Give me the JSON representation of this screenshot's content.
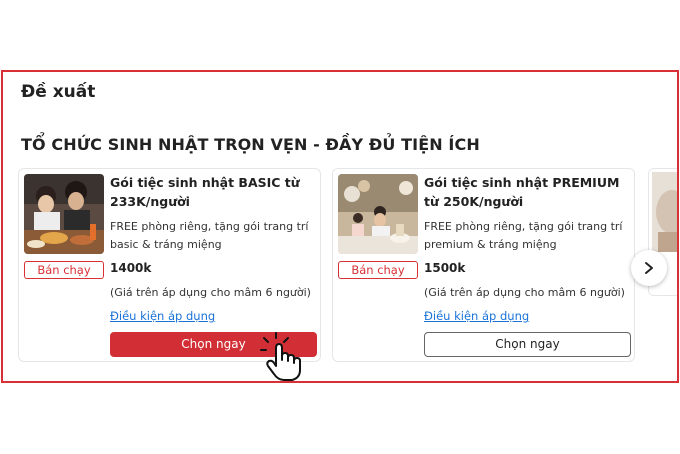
{
  "section": {
    "title": "Đề xuất"
  },
  "group": {
    "title": "TỔ CHỨC SINH NHẬT TRỌN VẸN - ĐẦY ĐỦ TIỆN ÍCH"
  },
  "cards": [
    {
      "badge": "Bán chạy",
      "title": "Gói tiệc sinh nhật BASIC từ 233K/người",
      "desc": "FREE phòng riêng, tặng gói trang trí basic & tráng miệng",
      "price": "1400k",
      "note": "(Giá trên áp dụng cho mâm 6 người)",
      "link": "Điều kiện áp dụng",
      "button": "Chọn ngay"
    },
    {
      "badge": "Bán chạy",
      "title": "Gói tiệc sinh nhật PREMIUM từ 250K/người",
      "desc": "FREE phòng riêng, tặng gói trang trí premium & tráng miệng",
      "price": "1500k",
      "note": "(Giá trên áp dụng cho mâm 6 người)",
      "link": "Điều kiện áp dụng",
      "button": "Chọn ngay"
    }
  ],
  "icons": {
    "next": "chevron-right-icon",
    "cursor": "hand-pointer-icon"
  },
  "colors": {
    "accent": "#d12f35",
    "link": "#1a73d9",
    "border": "#d93035"
  }
}
